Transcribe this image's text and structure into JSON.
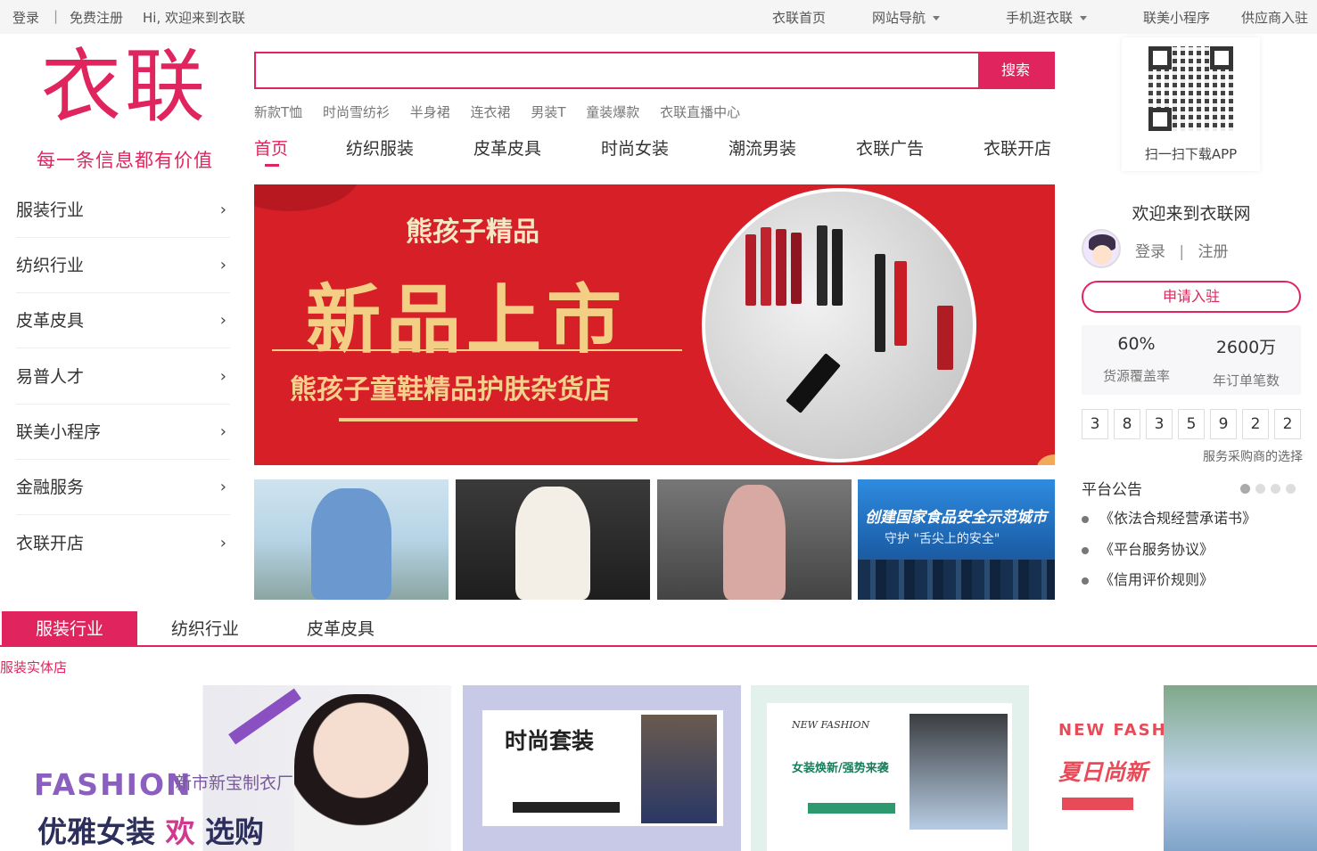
{
  "topbar": {
    "login": "登录",
    "sep": "|",
    "register": "免费注册",
    "greeting": "Hi, 欢迎来到衣联",
    "links": [
      "衣联首页",
      "网站导航",
      "手机逛衣联",
      "联美小程序",
      "供应商入驻"
    ]
  },
  "logo": {
    "name": "衣联",
    "slogan": "每一条信息都有价值"
  },
  "search": {
    "value": "",
    "button": "搜索"
  },
  "hotwords": [
    "新款T恤",
    "时尚雪纺衫",
    "半身裙",
    "连衣裙",
    "男装T",
    "童装爆款",
    "衣联直播中心"
  ],
  "nav": [
    "首页",
    "纺织服装",
    "皮革皮具",
    "时尚女装",
    "潮流男装",
    "衣联广告",
    "衣联开店"
  ],
  "qr": {
    "label": "扫一扫下载APP"
  },
  "sidebar": {
    "items": [
      "服装行业",
      "纺织行业",
      "皮革皮具",
      "易普人才",
      "联美小程序",
      "金融服务",
      "衣联开店"
    ]
  },
  "banner": {
    "brand": "熊孩子精品",
    "headline": "新品上市",
    "shop": "熊孩子童鞋精品护肤杂货店"
  },
  "thumbs": {
    "city_title": "创建国家食品安全示范城市",
    "city_sub": "守护 \"舌尖上的安全\""
  },
  "side": {
    "welcome": "欢迎来到衣联网",
    "login": "登录",
    "sep": "|",
    "register": "注册",
    "apply": "申请入驻",
    "stats": [
      {
        "value": "60%",
        "label": "货源覆盖率"
      },
      {
        "value": "2600万",
        "label": "年订单笔数"
      }
    ],
    "digits": [
      "3",
      "8",
      "3",
      "5",
      "9",
      "2",
      "2"
    ],
    "digits_caption": "服务采购商的选择",
    "notice_title": "平台公告",
    "notices": [
      "《依法合规经营承诺书》",
      "《平台服务协议》",
      "《信用评价规则》"
    ]
  },
  "tabs": [
    "服装行业",
    "纺织行业",
    "皮革皮具"
  ],
  "subcategory": "服装实体店",
  "cards": {
    "c1": {
      "fashion": "FASHION",
      "brand": "新市新宝制衣厂",
      "slogan_a": "优雅女装",
      "slogan_b": "欢",
      "slogan_c": "选购"
    },
    "c2": {
      "title": "时尚套装"
    },
    "c3": {
      "new_fashion": "NEW FASHION",
      "title": "女装焕新/强势来袭"
    },
    "c4": {
      "new_fashion": "NEW FASHION",
      "title": "夏日尚新"
    }
  }
}
